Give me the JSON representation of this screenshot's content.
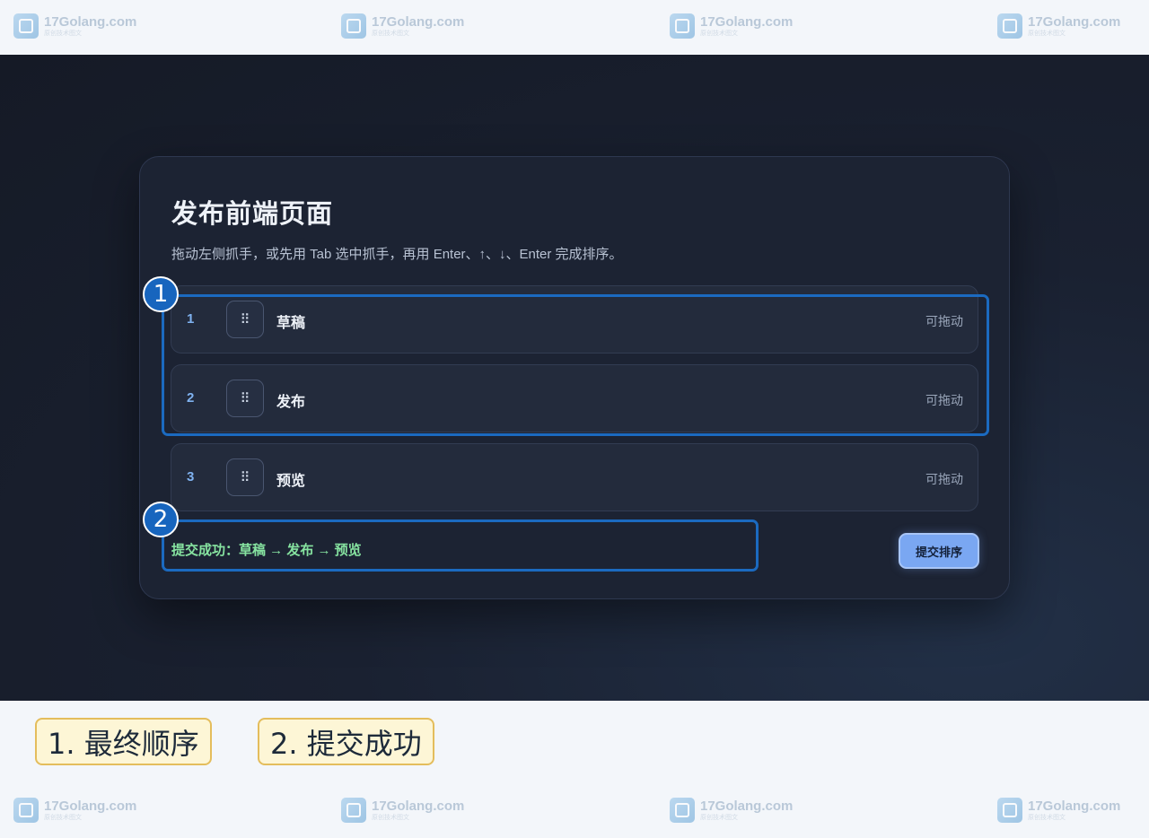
{
  "watermark": {
    "text": "17Golang.com",
    "subtitle": "原创技术图文"
  },
  "page": {
    "title": "发布前端页面",
    "description": "拖动左侧抓手，或先用 Tab 选中抓手，再用 Enter、↑、↓、Enter 完成排序。",
    "grip_glyph": "⠿",
    "items": [
      {
        "number": "1",
        "label": "草稿",
        "tag": "可拖动"
      },
      {
        "number": "2",
        "label": "发布",
        "tag": "可拖动"
      },
      {
        "number": "3",
        "label": "预览",
        "tag": "可拖动"
      }
    ],
    "status": "提交成功：草稿 → 发布 → 预览",
    "submit_label": "提交排序"
  },
  "callouts": [
    {
      "badge": "1",
      "legend": "1. 最终顺序"
    },
    {
      "badge": "2",
      "legend": "2. 提交成功"
    }
  ],
  "colors": {
    "accent": "#7aa7f2",
    "success": "#86e3a0",
    "callout": "#1b6ac0",
    "legend_bg": "#fdf6d6"
  }
}
